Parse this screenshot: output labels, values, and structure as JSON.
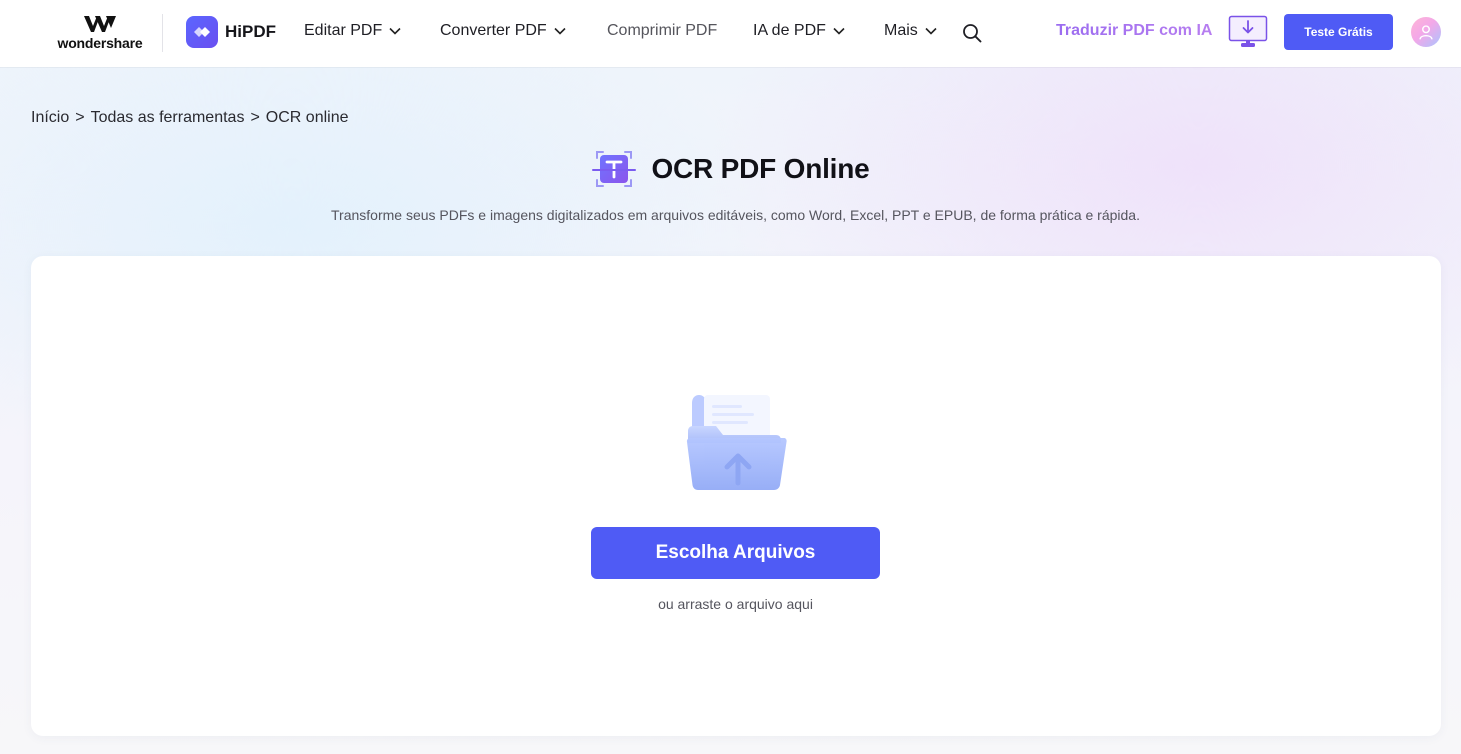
{
  "header": {
    "brand": "wondershare",
    "product": "HiPDF",
    "nav": [
      {
        "label": "Editar PDF",
        "dropdown": true
      },
      {
        "label": "Converter PDF",
        "dropdown": true
      },
      {
        "label": "Comprimir PDF",
        "dropdown": false
      },
      {
        "label": "IA de PDF",
        "dropdown": true
      },
      {
        "label": "Mais",
        "dropdown": true
      }
    ],
    "translate_link": "Traduzir PDF com IA",
    "trial_button": "Teste Grátis"
  },
  "breadcrumb": [
    "Início",
    ">",
    "Todas as ferramentas",
    ">",
    "OCR online"
  ],
  "main": {
    "title": "OCR PDF Online",
    "subtitle": "Transforme seus PDFs e imagens digitalizados em arquivos editáveis, como Word, Excel, PPT e EPUB, de forma prática e rápida.",
    "choose_button": "Escolha Arquivos",
    "drag_hint": "ou arraste o arquivo aqui"
  },
  "colors": {
    "accent": "#4f5bf5",
    "translate_gradient_start": "#9b6cf0",
    "translate_gradient_end": "#b77ef0"
  },
  "icons": [
    "wondershare-logo-icon",
    "hipdf-logo-icon",
    "chevron-down-icon",
    "search-icon",
    "desktop-download-icon",
    "user-avatar-icon",
    "ocr-scan-icon",
    "folder-upload-icon"
  ]
}
